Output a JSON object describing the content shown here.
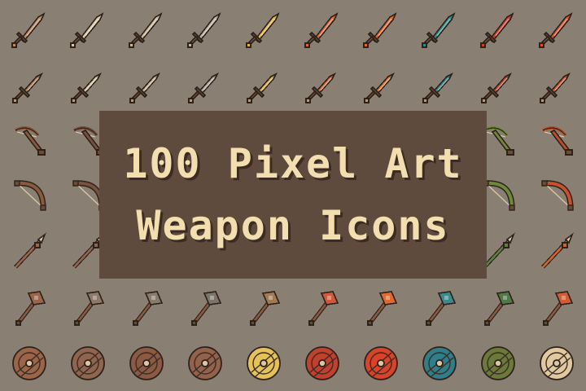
{
  "banner": {
    "line1": "100 Pixel Art",
    "line2": "Weapon Icons"
  },
  "colors": {
    "background": "#8a7f73",
    "banner_bg": "#5f4b3e",
    "banner_text": "#f3deb0",
    "outline": "#2e211a"
  },
  "icon_rows": [
    {
      "icon": "sword-icon",
      "palettes": [
        "#c08a62",
        "#d9c7a8",
        "#c9b79a",
        "#bdb3a5",
        "#e0b54a",
        "#d86a3a",
        "#e3692b",
        "#2f8a8a",
        "#c8402a",
        "#d8522a"
      ]
    },
    {
      "icon": "dagger-icon",
      "palettes": [
        "#b5805e",
        "#d7c6a6",
        "#c7b597",
        "#b3aa9e",
        "#dfb24a",
        "#dc6a3c",
        "#e27a2c",
        "#2f8c90",
        "#c24a2e",
        "#d65a2c"
      ]
    },
    {
      "icon": "crossbow-icon",
      "palettes": [
        "#8a5a3e",
        "#7a5140",
        "#7c5a42",
        "#7a6150",
        "#c88a3a",
        "#c26a3a",
        "#cf7b3b",
        "#3d7b6d",
        "#6d8a3a",
        "#b8502e"
      ]
    },
    {
      "icon": "bow-icon",
      "palettes": [
        "#8a5a3e",
        "#7a5140",
        "#7c5a42",
        "#7a6150",
        "#c88a3a",
        "#c26a3a",
        "#cf7b3b",
        "#3d7b6d",
        "#6d8a3a",
        "#c8502e"
      ]
    },
    {
      "icon": "spear-icon",
      "palettes": [
        "#9a6548",
        "#8d6652",
        "#8a6a52",
        "#84705e",
        "#d0953e",
        "#c56c40",
        "#d2803c",
        "#3f8070",
        "#5c8040",
        "#d2652e"
      ]
    },
    {
      "icon": "hammer-icon",
      "palettes": [
        "#9a6548",
        "#8d7a6a",
        "#8a7a6a",
        "#7b756c",
        "#a07a52",
        "#d0593a",
        "#e2692d",
        "#3b8a8c",
        "#4f7a48",
        "#d45a32"
      ]
    },
    {
      "icon": "shield-icon",
      "palettes": [
        "#9a6548",
        "#8f6550",
        "#8a5a44",
        "#93624c",
        "#e4c25a",
        "#c2402e",
        "#d8432a",
        "#2f7e8a",
        "#6a7a3a",
        "#e0c8a0"
      ]
    }
  ]
}
